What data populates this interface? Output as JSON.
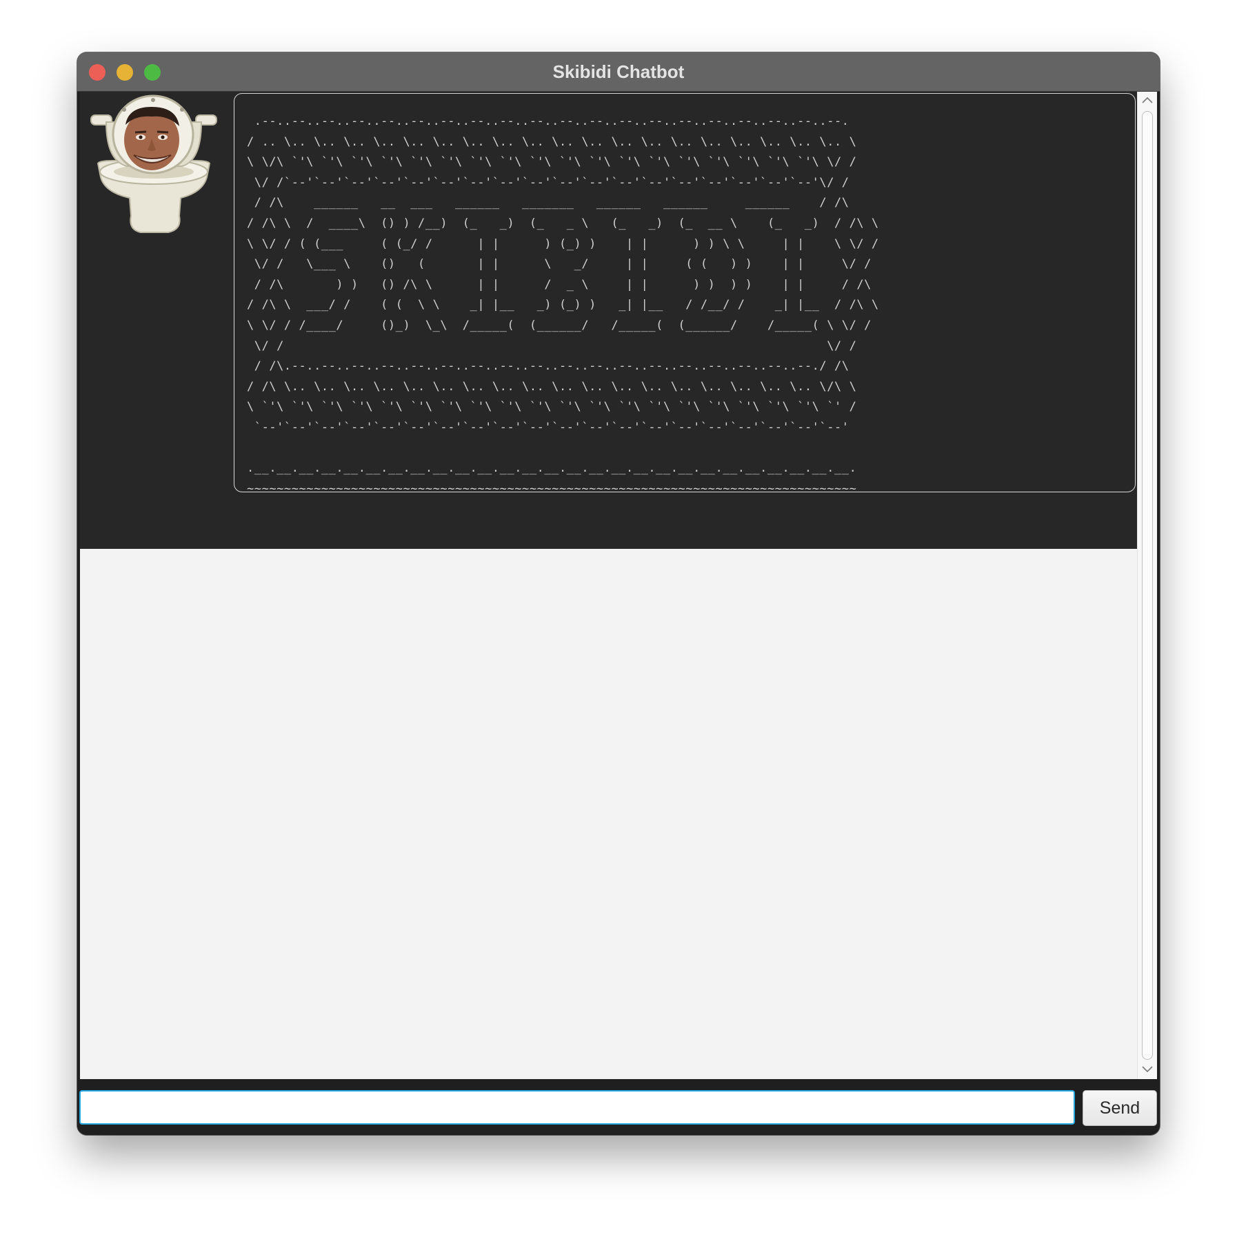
{
  "window": {
    "title": "Skibidi Chatbot"
  },
  "dialog": {
    "avatar_icon": "skibidi-toilet-avatar",
    "ascii_art": " .--..--..--..--..--..--..--..--..--..--..--..--..--..--..--..--..--..--..--..--.\n/ .. \\.. \\.. \\.. \\.. \\.. \\.. \\.. \\.. \\.. \\.. \\.. \\.. \\.. \\.. \\.. \\.. \\.. \\.. \\.. \\\n\\ \\/\\ `'\\ `'\\ `'\\ `'\\ `'\\ `'\\ `'\\ `'\\ `'\\ `'\\ `'\\ `'\\ `'\\ `'\\ `'\\ `'\\ `'\\ `'\\ \\/ /\n \\/ /`--'`--'`--'`--'`--'`--'`--'`--'`--'`--'`--'`--'`--'`--'`--'`--'`--'`--'\\/ /\n / /\\    ______   __  ___   ______   _______   ______   ______     ______    / /\\\n/ /\\ \\  /  ____\\  () ) /__)  (_   _)  (_   _ \\   (_   _)  (_  __ \\    (_   _)  / /\\ \\\n\\ \\/ / ( (___     ( (_/ /      | |      ) (_) )    | |      ) ) \\ \\     | |    \\ \\/ /\n \\/ /   \\___ \\    ()   (       | |      \\   _/     | |     ( (   ) )    | |     \\/ /\n / /\\       ) )   () /\\ \\      | |      /  _ \\     | |      ) )  ) )    | |     / /\\\n/ /\\ \\  ___/ /    ( (  \\ \\    _| |__   _) (_) )   _| |__   / /__/ /    _| |__  / /\\ \\\n\\ \\/ / /____/     ()_)  \\_\\  /_____(  (______/   /_____(  (______/    /_____( \\ \\/ /\n \\/ /                                                                         \\/ /\n / /\\.--..--..--..--..--..--..--..--..--..--..--..--..--..--..--..--..--..--./ /\\\n/ /\\ \\.. \\.. \\.. \\.. \\.. \\.. \\.. \\.. \\.. \\.. \\.. \\.. \\.. \\.. \\.. \\.. \\.. \\.. \\/\\ \\\n\\ `'\\ `'\\ `'\\ `'\\ `'\\ `'\\ `'\\ `'\\ `'\\ `'\\ `'\\ `'\\ `'\\ `'\\ `'\\ `'\\ `'\\ `'\\ `'\\ `' /\n `--'`--'`--'`--'`--'`--'`--'`--'`--'`--'`--'`--'`--'`--'`--'`--'`--'`--'`--'`--'\n\n.__.__.__.__.__.__.__.__.__.__.__.__.__.__.__.__.__.__.__.__.__.__.__.__.__.__.__.\n~~~~~~~~~~~~~~~~~~~~~~~~~~~~~~~~~~~~~~~~~~~~~~~~~~~~~~~~~~~~~~~~~~~~~~~~~~~~~~~~~~"
  },
  "scrollbar": {
    "up_icon": "chevron-up-icon",
    "down_icon": "chevron-down-icon"
  },
  "input": {
    "value": "",
    "placeholder": ""
  },
  "send_button": {
    "label": "Send"
  },
  "colors": {
    "window_bg": "#1f1f1f",
    "titlebar": "#646464",
    "dialog_bg": "#272727",
    "chat_bg": "#f3f3f3",
    "input_focus": "#29a7e0"
  }
}
